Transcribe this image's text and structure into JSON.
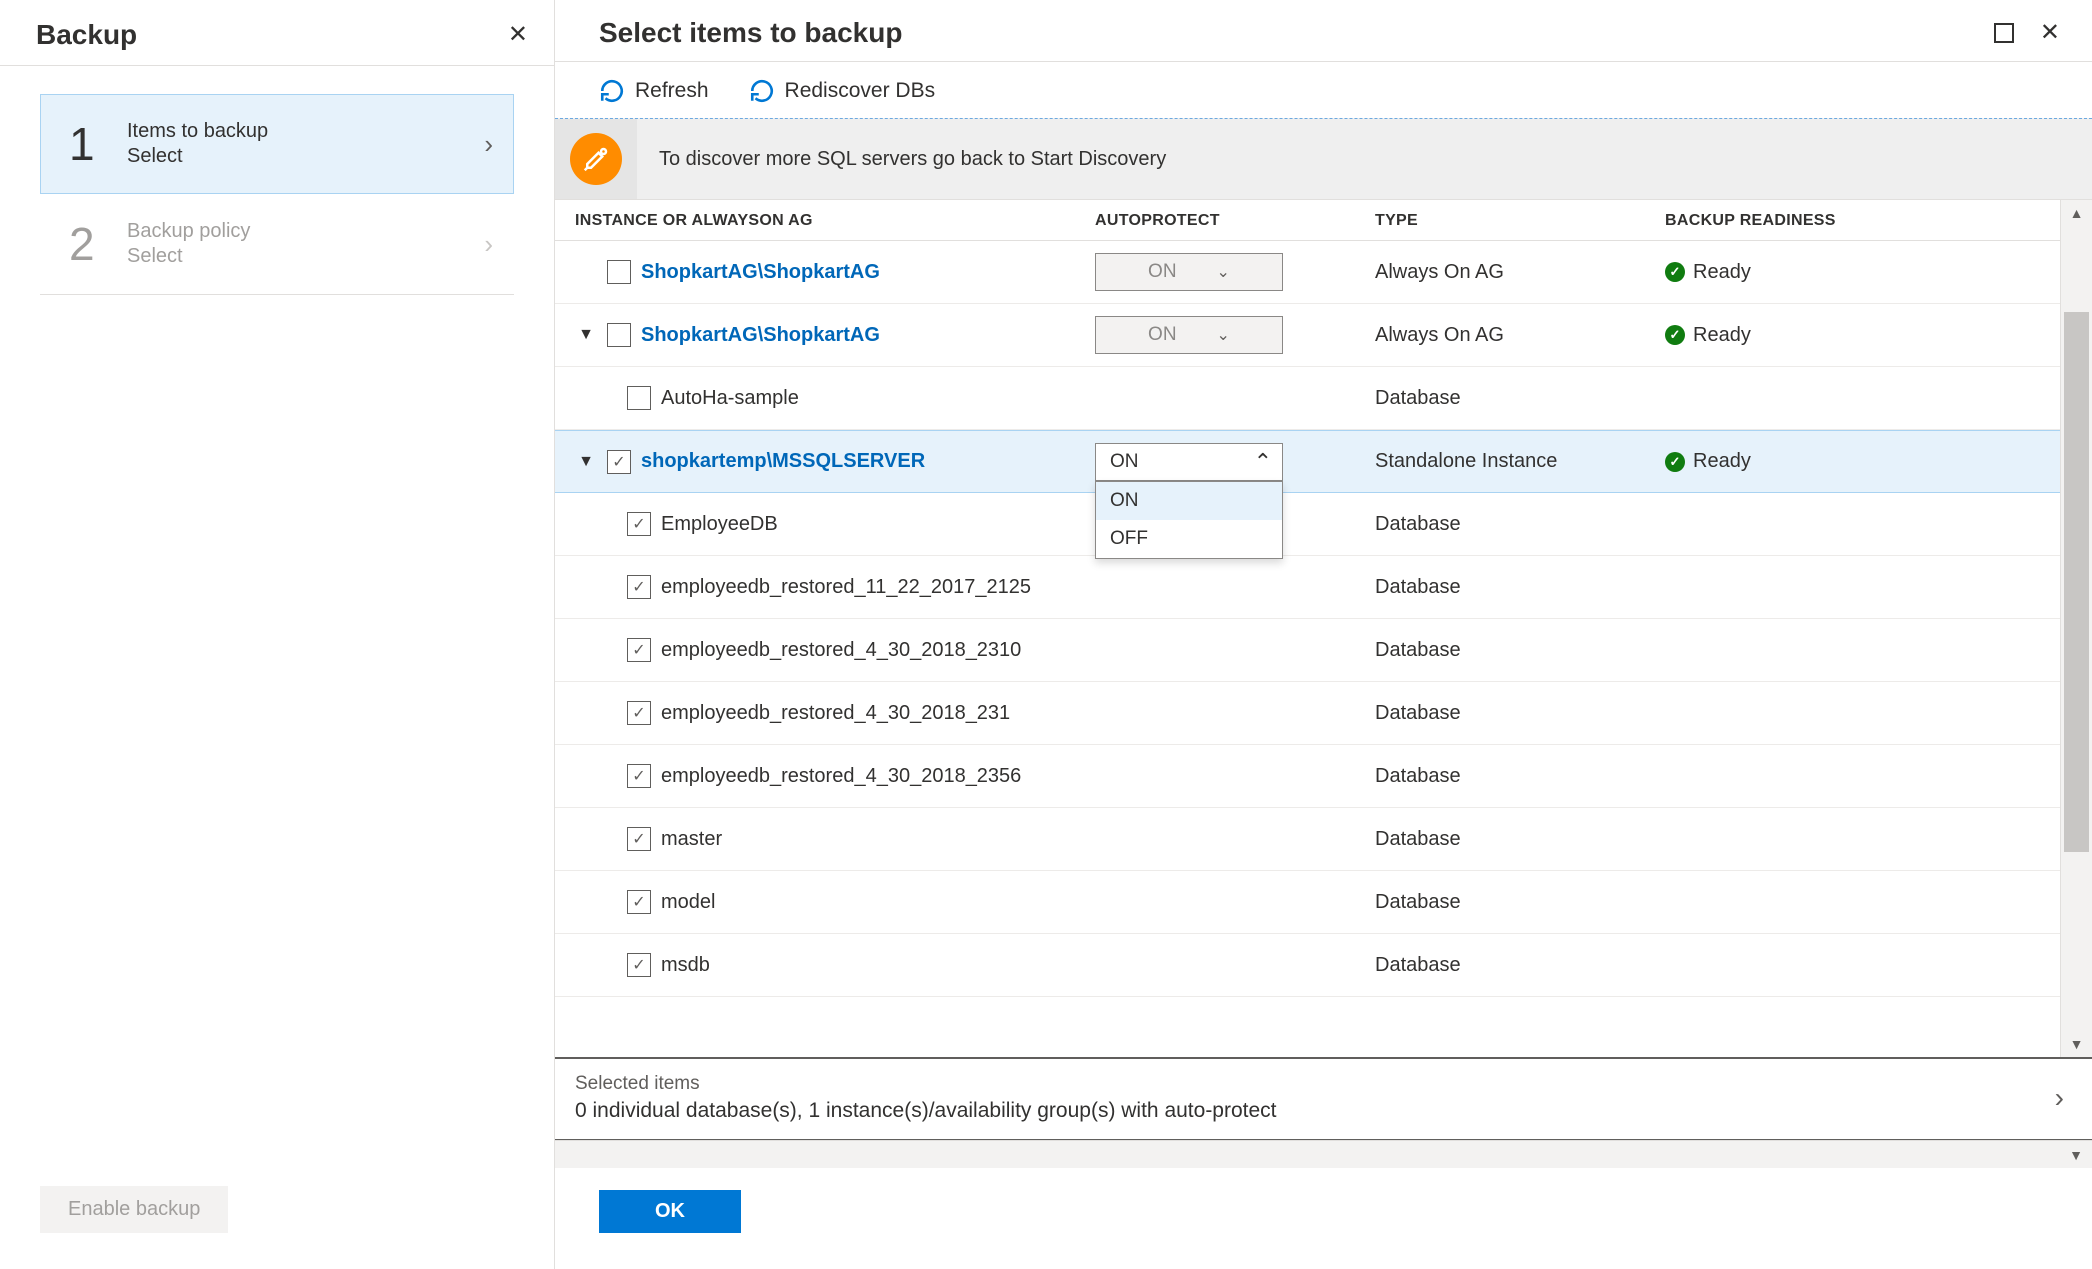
{
  "left": {
    "title": "Backup",
    "steps": [
      {
        "num": "1",
        "title": "Items to backup",
        "sub": "Select",
        "active": true
      },
      {
        "num": "2",
        "title": "Backup policy",
        "sub": "Select",
        "active": false
      }
    ],
    "enable_label": "Enable backup"
  },
  "right": {
    "title": "Select items to backup",
    "toolbar": {
      "refresh": "Refresh",
      "rediscover": "Rediscover DBs"
    },
    "banner": "To discover more SQL servers go back to Start Discovery",
    "columns": {
      "instance": "INSTANCE OR ALWAYSON AG",
      "autoprotect": "AUTOPROTECT",
      "type": "TYPE",
      "readiness": "BACKUP READINESS"
    },
    "rows": [
      {
        "kind": "group",
        "name": "ShopkartAG\\ShopkartAG",
        "expandable": false,
        "expanded": false,
        "checked": false,
        "autoprotect": "ON",
        "autoprotect_disabled": true,
        "type": "Always On AG",
        "ready": "Ready",
        "indent": 0
      },
      {
        "kind": "group",
        "name": "ShopkartAG\\ShopkartAG",
        "expandable": true,
        "expanded": true,
        "checked": false,
        "autoprotect": "ON",
        "autoprotect_disabled": true,
        "type": "Always On AG",
        "ready": "Ready",
        "indent": 0
      },
      {
        "kind": "db",
        "name": "AutoHa-sample",
        "checked": false,
        "type": "Database",
        "indent": 1
      },
      {
        "kind": "group",
        "name": "shopkartemp\\MSSQLSERVER",
        "expandable": true,
        "expanded": true,
        "checked": true,
        "autoprotect": "ON",
        "autoprotect_disabled": false,
        "autoprotect_open": true,
        "type": "Standalone Instance",
        "ready": "Ready",
        "indent": 0,
        "selected": true
      },
      {
        "kind": "db",
        "name": "EmployeeDB",
        "checked": true,
        "type": "Database",
        "indent": 1
      },
      {
        "kind": "db",
        "name": "employeedb_restored_11_22_2017_2125",
        "checked": true,
        "type": "Database",
        "indent": 1
      },
      {
        "kind": "db",
        "name": "employeedb_restored_4_30_2018_2310",
        "checked": true,
        "type": "Database",
        "indent": 1
      },
      {
        "kind": "db",
        "name": "employeedb_restored_4_30_2018_231",
        "checked": true,
        "type": "Database",
        "indent": 1
      },
      {
        "kind": "db",
        "name": "employeedb_restored_4_30_2018_2356",
        "checked": true,
        "type": "Database",
        "indent": 1
      },
      {
        "kind": "db",
        "name": "master",
        "checked": true,
        "type": "Database",
        "indent": 1
      },
      {
        "kind": "db",
        "name": "model",
        "checked": true,
        "type": "Database",
        "indent": 1
      },
      {
        "kind": "db",
        "name": "msdb",
        "checked": true,
        "type": "Database",
        "indent": 1
      }
    ],
    "dropdown_options": {
      "on": "ON",
      "off": "OFF"
    },
    "selected": {
      "title": "Selected items",
      "summary": "0 individual database(s), 1 instance(s)/availability group(s) with auto-protect"
    },
    "ok_label": "OK"
  }
}
